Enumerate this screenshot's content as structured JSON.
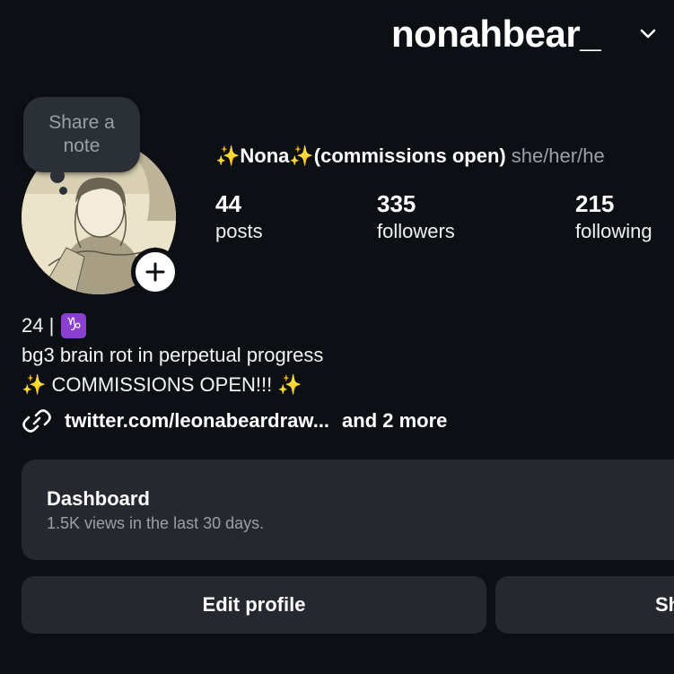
{
  "header": {
    "username": "nonahbear_"
  },
  "note": {
    "line1": "Share a",
    "line2": "note"
  },
  "profile": {
    "display_name": "✨Nona✨(commissions open)",
    "pronouns": "she/her/he"
  },
  "stats": {
    "posts": {
      "value": "44",
      "label": "posts"
    },
    "followers": {
      "value": "335",
      "label": "followers"
    },
    "following": {
      "value": "215",
      "label": "following"
    }
  },
  "bio": {
    "line1": "24 |",
    "zodiac": "♑",
    "line2": "bg3 brain rot in perpetual progress",
    "line3_sparkle_left": "✨",
    "line3_text": "COMMISSIONS OPEN!!!",
    "line3_sparkle_right": "✨"
  },
  "link": {
    "url": "twitter.com/leonabeardraw...",
    "more": "and 2 more"
  },
  "dashboard": {
    "title": "Dashboard",
    "subtitle": "1.5K views in the last 30 days."
  },
  "buttons": {
    "edit_profile": "Edit profile",
    "share_profile": "Sh"
  },
  "colors": {
    "background": "#0c0f14",
    "card": "#25282e",
    "secondary_text": "#9aa0a8",
    "zodiac_badge": "#8a3fd1"
  }
}
